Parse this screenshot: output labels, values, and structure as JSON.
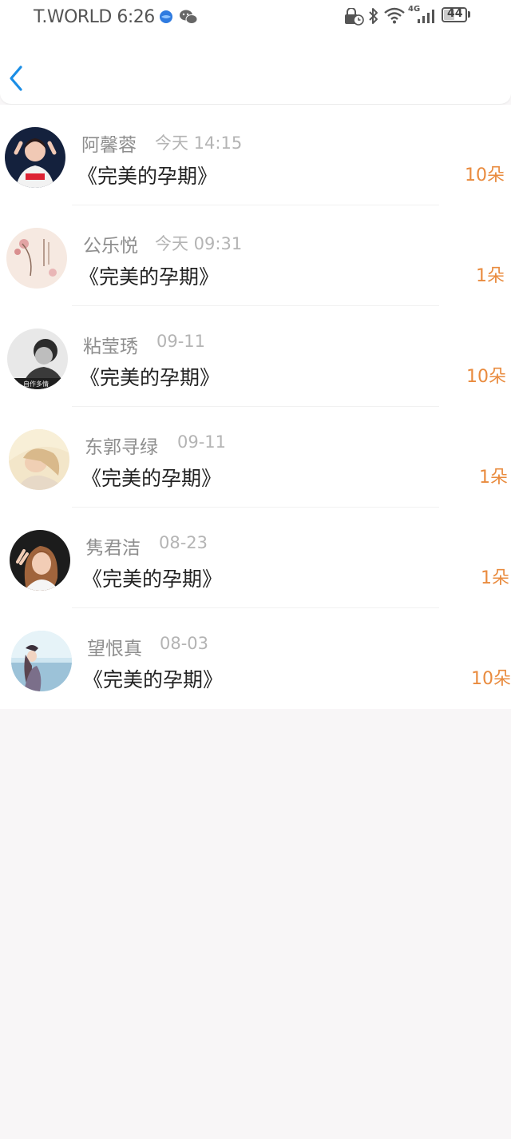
{
  "status_bar": {
    "carrier_time": "T.WORLD 6:26",
    "network": "4G",
    "battery": "44"
  },
  "header": {
    "back_icon": "chevron-left-icon",
    "accent": "#1a8ee6"
  },
  "colors": {
    "count": "#e98b3e",
    "title": "#222222",
    "name": "#8e8e8e",
    "time": "#b4b4b4"
  },
  "list": {
    "items": [
      {
        "name": "阿馨蓉",
        "time": "今天 14:15",
        "title": "《完美的孕期》",
        "count": "10朵"
      },
      {
        "name": "公乐悦",
        "time": "今天 09:31",
        "title": "《完美的孕期》",
        "count": "1朵"
      },
      {
        "name": "粘莹琇",
        "time": "09-11",
        "title": "《完美的孕期》",
        "count": "10朵"
      },
      {
        "name": "东郭寻绿",
        "time": "09-11",
        "title": "《完美的孕期》",
        "count": "1朵"
      },
      {
        "name": "隽君洁",
        "time": "08-23",
        "title": "《完美的孕期》",
        "count": "1朵"
      },
      {
        "name": "望恨真",
        "time": "08-03",
        "title": "《完美的孕期》",
        "count": "10朵"
      }
    ]
  }
}
